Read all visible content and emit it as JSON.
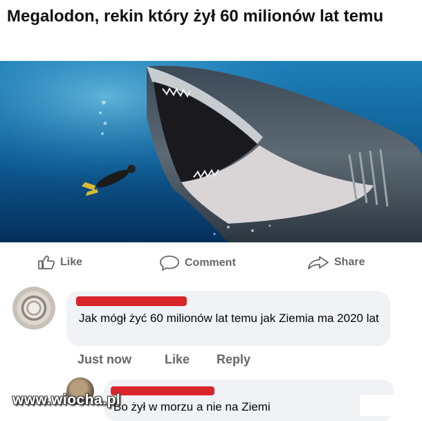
{
  "post": {
    "title": "Megalodon, rekin który żył 60 milionów lat temu"
  },
  "actions": {
    "like": "Like",
    "comment": "Comment",
    "share": "Share"
  },
  "comment": {
    "text": "Jak mógł żyć 60 milionów lat temu jak Ziemia ma 2020 lat",
    "time": "Just now",
    "like": "Like",
    "reply": "Reply"
  },
  "reply": {
    "text": "Bo żył w morzu a nie na Ziemi"
  },
  "watermark": "www.wiocha.pl",
  "icons": {
    "like": "thumbs-up-icon",
    "comment": "speech-bubble-icon",
    "share": "share-arrow-icon"
  },
  "colors": {
    "redaction": "#d8262b",
    "action_text": "#65676b",
    "bubble": "#f0f2f5"
  }
}
